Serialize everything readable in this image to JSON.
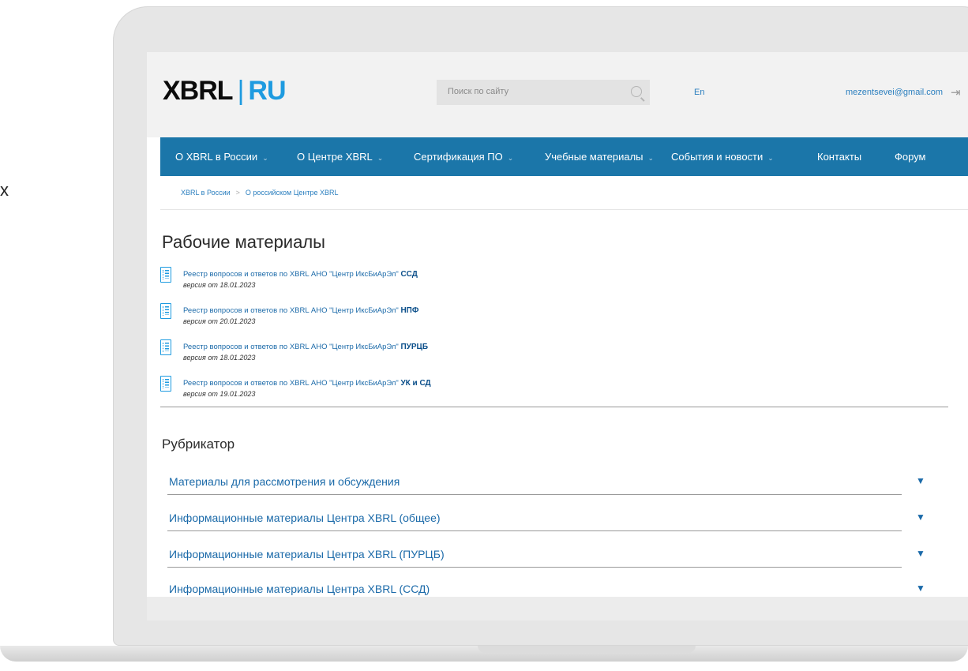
{
  "side_fragment": "х",
  "header": {
    "logo": {
      "x": "XBRL",
      "separator": "|",
      "ru": "RU"
    },
    "search_placeholder": "Поиск по сайту",
    "lang": "En",
    "email": "mezentsevei@gmail.com",
    "login_icon": "login-icon"
  },
  "nav": {
    "items": [
      {
        "label": "О XBRL в России",
        "dropdown": true
      },
      {
        "label": "О Центре XBRL",
        "dropdown": true
      },
      {
        "label": "Сертификация ПО",
        "dropdown": true
      },
      {
        "label": "Учебные материалы",
        "dropdown": true
      },
      {
        "label": "События и новости",
        "dropdown": true
      },
      {
        "label": "Контакты",
        "dropdown": false
      },
      {
        "label": "Форум",
        "dropdown": false
      }
    ],
    "caret": "⌄"
  },
  "breadcrumb": {
    "items": [
      "XBRL в России",
      "О российском Центре XBRL"
    ],
    "separator": ">"
  },
  "materials": {
    "title": "Рабочие материалы",
    "items": [
      {
        "text": "Реестр вопросов и ответов по XBRL АНО \"Центр ИксБиАрЭл\"",
        "tag": "ССД",
        "version": "версия от 18.01.2023"
      },
      {
        "text": "Реестр вопросов и ответов по XBRL АНО \"Центр ИксБиАрЭл\"",
        "tag": "НПФ",
        "version": "версия от 20.01.2023"
      },
      {
        "text": "Реестр вопросов и ответов по XBRL АНО \"Центр ИксБиАрЭл\"",
        "tag": "ПУРЦБ",
        "version": "версия от 18.01.2023"
      },
      {
        "text": "Реестр вопросов и ответов по XBRL АНО \"Центр ИксБиАрЭл\"",
        "tag": "УК и СД",
        "version": "версия от 19.01.2023"
      }
    ]
  },
  "rubricator": {
    "title": "Рубрикатор",
    "items": [
      "Материалы для рассмотрения и обсуждения",
      "Информационные материалы Центра XBRL (общее)",
      "Информационные материалы Центра XBRL (ПУРЦБ)",
      "Информационные материалы Центра XBRL (ССД)"
    ],
    "arrow": "▼"
  },
  "colors": {
    "nav_bg": "#1b76a9",
    "link": "#1b6aa9",
    "logo_accent": "#1e9be0"
  }
}
